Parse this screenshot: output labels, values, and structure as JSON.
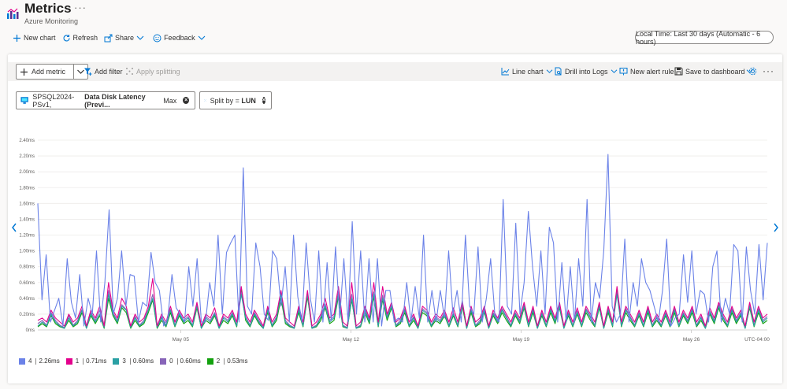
{
  "app": {
    "title": "Metrics",
    "subtitle": "Azure Monitoring",
    "more": "···"
  },
  "commands": {
    "new_chart": "New chart",
    "refresh": "Refresh",
    "share": "Share",
    "feedback": "Feedback",
    "time_range": "Local Time: Last 30 days (Automatic - 6 hours)"
  },
  "toolbar": {
    "add_metric": "Add metric",
    "add_filter": "Add filter",
    "apply_splitting": "Apply splitting",
    "line_chart": "Line chart",
    "drill_into_logs": "Drill into Logs",
    "new_alert_rule": "New alert rule",
    "save_to_dashboard": "Save to dashboard",
    "more": "···"
  },
  "metric_pill": {
    "resource": "SPSQL2024-PSv1,",
    "metric": "Data Disk Latency (Previ...",
    "aggregation": "Max"
  },
  "split_pill": {
    "prefix": "Split by = ",
    "value": "LUN"
  },
  "timezone_label": "UTC-04:00",
  "colors": {
    "accent": "#0078d4",
    "series_4": "#6b82e8",
    "series_1": "#e3008c",
    "series_3": "#2aa0a4",
    "series_0": "#8764b8",
    "series_2": "#13a10e"
  },
  "legend": [
    {
      "name": "4",
      "value": "2.26ms",
      "color": "#6b82e8"
    },
    {
      "name": "1",
      "value": "0.71ms",
      "color": "#e3008c"
    },
    {
      "name": "3",
      "value": "0.60ms",
      "color": "#2aa0a4"
    },
    {
      "name": "0",
      "value": "0.60ms",
      "color": "#8764b8"
    },
    {
      "name": "2",
      "value": "0.53ms",
      "color": "#13a10e"
    }
  ],
  "chart_data": {
    "type": "line",
    "ylabels": [
      "2.40ms",
      "2.20ms",
      "2.00ms",
      "1.80ms",
      "1.60ms",
      "1.40ms",
      "1.20ms",
      "1.00ms",
      "0.80ms",
      "0.60ms",
      "0.40ms",
      "0.20ms",
      "0ms"
    ],
    "ylim": [
      0,
      2.4
    ],
    "xlim": [
      0,
      120
    ],
    "xticks": [
      {
        "label": "May 05",
        "x": 23.5
      },
      {
        "label": "May 12",
        "x": 51.5
      },
      {
        "label": "May 19",
        "x": 79.5
      },
      {
        "label": "May 26",
        "x": 107.5
      }
    ],
    "grid": true,
    "series": [
      {
        "name": "4",
        "color": "#6b82e8",
        "values": [
          1.6,
          0.38,
          0.95,
          0.1,
          0.25,
          0.4,
          0.05,
          0.9,
          0.35,
          0.15,
          0.7,
          0.05,
          0.4,
          0.2,
          1.0,
          0.1,
          0.6,
          1.52,
          0.2,
          0.4,
          1.0,
          0.3,
          0.7,
          0.68,
          0.1,
          0.35,
          0.3,
          0.98,
          0.6,
          0.5,
          0.05,
          0.15,
          0.7,
          0.28,
          0.2,
          0.1,
          0.8,
          0.3,
          0.9,
          0.1,
          0.1,
          0.6,
          0.3,
          1.2,
          0.2,
          0.98,
          1.1,
          1.2,
          0.1,
          2.05,
          0.3,
          0.2,
          1.1,
          0.8,
          0.2,
          0.12,
          1.0,
          0.9,
          0.3,
          0.8,
          0.1,
          1.2,
          0.42,
          0.1,
          1.1,
          0.4,
          0.1,
          1.0,
          0.1,
          0.85,
          0.12,
          1.05,
          0.15,
          0.9,
          0.1,
          1.37,
          0.2,
          1.0,
          0.1,
          0.9,
          0.1,
          0.9,
          0.05,
          0.5,
          0.5,
          0.1,
          0.15,
          0.1,
          0.6,
          0.1,
          0.55,
          0.15,
          1.2,
          0.1,
          0.5,
          0.1,
          0.5,
          0.15,
          1.0,
          0.2,
          0.5,
          0.1,
          1.2,
          0.3,
          0.2,
          1.05,
          0.1,
          0.4,
          0.9,
          0.2,
          0.1,
          1.65,
          0.3,
          0.2,
          1.35,
          0.2,
          0.6,
          1.5,
          0.8,
          0.3,
          1.0,
          0.2,
          1.3,
          1.1,
          0.1,
          0.85,
          0.1,
          0.8,
          0.1,
          0.9,
          0.3,
          1.65,
          0.1,
          0.6,
          0.4,
          1.0,
          2.22,
          0.3,
          0.1,
          0.2,
          1.15,
          0.1,
          0.6,
          0.3,
          0.9,
          0.6,
          0.5,
          0.3,
          0.1,
          0.5,
          1.15,
          0.05,
          0.15,
          0.2,
          0.95,
          0.35,
          1.0,
          0.2,
          0.5,
          0.45,
          0.1,
          0.8,
          1.0,
          0.1,
          0.4,
          0.2,
          1.08,
          1.0,
          0.1,
          1.05,
          0.5,
          0.2,
          1.08,
          0.38,
          1.1
        ]
      },
      {
        "name": "1",
        "color": "#e3008c",
        "values": [
          0.12,
          0.15,
          0.1,
          0.25,
          0.15,
          0.1,
          0.05,
          0.2,
          0.1,
          0.15,
          0.3,
          0.05,
          0.25,
          0.15,
          0.3,
          0.05,
          0.6,
          0.25,
          0.15,
          0.4,
          0.3,
          0.05,
          0.2,
          0.1,
          0.15,
          0.3,
          0.65,
          0.05,
          0.2,
          0.1,
          0.3,
          0.1,
          0.25,
          0.15,
          0.2,
          0.1,
          0.35,
          0.05,
          0.2,
          0.15,
          0.28,
          0.05,
          0.2,
          0.15,
          0.25,
          0.1,
          0.55,
          0.2,
          0.1,
          0.25,
          0.15,
          0.05,
          0.3,
          0.1,
          0.2,
          0.5,
          0.15,
          0.1,
          0.05,
          0.3,
          0.1,
          0.5,
          0.05,
          0.1,
          0.2,
          0.4,
          0.15,
          0.2,
          0.55,
          0.1,
          0.05,
          0.6,
          0.05,
          0.1,
          0.3,
          0.15,
          0.6,
          0.1,
          0.55,
          0.2,
          0.35,
          0.1,
          0.15,
          0.3,
          0.1,
          0.2,
          0.05,
          0.3,
          0.25,
          0.1,
          0.2,
          0.15,
          0.25,
          0.1,
          0.28,
          0.1,
          0.35,
          0.05,
          0.3,
          0.1,
          0.15,
          0.3,
          0.05,
          0.25,
          0.15,
          0.3,
          0.2,
          0.1,
          0.25,
          0.15,
          0.35,
          0.1,
          0.3,
          0.05,
          0.25,
          0.1,
          0.3,
          0.15,
          0.35,
          0.05,
          0.25,
          0.1,
          0.28,
          0.1,
          0.3,
          0.2,
          0.1,
          0.35,
          0.05,
          0.3,
          0.1,
          0.55,
          0.1,
          0.3,
          0.2,
          0.1,
          0.25,
          0.1,
          0.3,
          0.1,
          0.2,
          0.1,
          0.25,
          0.1,
          0.3,
          0.1,
          0.25,
          0.15,
          0.3,
          0.1,
          0.2,
          0.05,
          0.28,
          0.15,
          0.35,
          0.2,
          0.1,
          0.3,
          0.15,
          0.25,
          0.05,
          0.35,
          0.1,
          0.3,
          0.15,
          0.2
        ]
      },
      {
        "name": "3",
        "color": "#2aa0a4",
        "values": [
          0.05,
          0.1,
          0.05,
          0.2,
          0.1,
          0.05,
          0.02,
          0.15,
          0.05,
          0.1,
          0.25,
          0.02,
          0.2,
          0.1,
          0.2,
          0.03,
          0.45,
          0.2,
          0.1,
          0.3,
          0.25,
          0.03,
          0.15,
          0.05,
          0.1,
          0.25,
          0.4,
          0.03,
          0.15,
          0.05,
          0.25,
          0.05,
          0.2,
          0.1,
          0.15,
          0.05,
          0.3,
          0.02,
          0.15,
          0.1,
          0.2,
          0.02,
          0.15,
          0.1,
          0.2,
          0.05,
          0.45,
          0.15,
          0.05,
          0.2,
          0.1,
          0.02,
          0.25,
          0.05,
          0.15,
          0.45,
          0.1,
          0.05,
          0.02,
          0.25,
          0.05,
          0.45,
          0.02,
          0.05,
          0.15,
          0.3,
          0.1,
          0.15,
          0.45,
          0.05,
          0.02,
          0.4,
          0.02,
          0.05,
          0.25,
          0.1,
          0.45,
          0.05,
          0.4,
          0.15,
          0.3,
          0.05,
          0.1,
          0.25,
          0.05,
          0.15,
          0.02,
          0.25,
          0.2,
          0.05,
          0.15,
          0.1,
          0.2,
          0.05,
          0.2,
          0.05,
          0.35,
          0.02,
          0.25,
          0.05,
          0.1,
          0.25,
          0.02,
          0.2,
          0.1,
          0.25,
          0.15,
          0.05,
          0.2,
          0.1,
          0.3,
          0.05,
          0.25,
          0.02,
          0.2,
          0.05,
          0.25,
          0.1,
          0.3,
          0.02,
          0.2,
          0.05,
          0.22,
          0.05,
          0.25,
          0.15,
          0.05,
          0.3,
          0.02,
          0.25,
          0.05,
          0.45,
          0.05,
          0.25,
          0.15,
          0.05,
          0.2,
          0.05,
          0.25,
          0.05,
          0.15,
          0.05,
          0.2,
          0.05,
          0.25,
          0.05,
          0.2,
          0.1,
          0.25,
          0.05,
          0.15,
          0.02,
          0.22,
          0.1,
          0.3,
          0.15,
          0.05,
          0.25,
          0.1,
          0.2,
          0.02,
          0.3,
          0.05,
          0.25,
          0.1,
          0.15
        ]
      },
      {
        "name": "0",
        "color": "#8764b8",
        "values": [
          0.08,
          0.12,
          0.06,
          0.22,
          0.12,
          0.06,
          0.03,
          0.18,
          0.06,
          0.12,
          0.26,
          0.03,
          0.22,
          0.12,
          0.25,
          0.04,
          0.5,
          0.22,
          0.12,
          0.32,
          0.26,
          0.04,
          0.17,
          0.06,
          0.12,
          0.26,
          0.45,
          0.04,
          0.17,
          0.06,
          0.26,
          0.06,
          0.22,
          0.12,
          0.17,
          0.06,
          0.32,
          0.03,
          0.17,
          0.12,
          0.22,
          0.03,
          0.17,
          0.12,
          0.22,
          0.06,
          0.48,
          0.17,
          0.06,
          0.22,
          0.12,
          0.03,
          0.27,
          0.06,
          0.17,
          0.47,
          0.12,
          0.06,
          0.03,
          0.27,
          0.06,
          0.47,
          0.03,
          0.06,
          0.17,
          0.33,
          0.12,
          0.17,
          0.48,
          0.06,
          0.03,
          0.45,
          0.03,
          0.06,
          0.27,
          0.12,
          0.48,
          0.06,
          0.44,
          0.17,
          0.32,
          0.06,
          0.12,
          0.27,
          0.06,
          0.17,
          0.03,
          0.27,
          0.22,
          0.06,
          0.17,
          0.12,
          0.22,
          0.06,
          0.22,
          0.06,
          0.37,
          0.03,
          0.27,
          0.06,
          0.12,
          0.27,
          0.03,
          0.22,
          0.12,
          0.27,
          0.17,
          0.06,
          0.22,
          0.12,
          0.32,
          0.06,
          0.27,
          0.03,
          0.22,
          0.06,
          0.27,
          0.12,
          0.32,
          0.03,
          0.22,
          0.06,
          0.24,
          0.06,
          0.27,
          0.17,
          0.06,
          0.32,
          0.03,
          0.27,
          0.06,
          0.48,
          0.06,
          0.27,
          0.17,
          0.06,
          0.22,
          0.06,
          0.27,
          0.06,
          0.17,
          0.06,
          0.22,
          0.06,
          0.27,
          0.06,
          0.22,
          0.12,
          0.27,
          0.06,
          0.17,
          0.03,
          0.24,
          0.12,
          0.32,
          0.17,
          0.06,
          0.27,
          0.12,
          0.22,
          0.03,
          0.32,
          0.06,
          0.27,
          0.12,
          0.17
        ]
      },
      {
        "name": "2",
        "color": "#13a10e",
        "values": [
          0.04,
          0.08,
          0.04,
          0.18,
          0.08,
          0.04,
          0.02,
          0.12,
          0.04,
          0.08,
          0.22,
          0.02,
          0.18,
          0.08,
          0.18,
          0.02,
          0.4,
          0.18,
          0.08,
          0.28,
          0.22,
          0.02,
          0.12,
          0.04,
          0.08,
          0.22,
          0.38,
          0.02,
          0.12,
          0.04,
          0.22,
          0.04,
          0.18,
          0.08,
          0.12,
          0.04,
          0.28,
          0.02,
          0.12,
          0.08,
          0.18,
          0.02,
          0.12,
          0.08,
          0.18,
          0.04,
          0.5,
          0.12,
          0.04,
          0.18,
          0.08,
          0.02,
          0.22,
          0.04,
          0.12,
          0.4,
          0.08,
          0.04,
          0.02,
          0.22,
          0.04,
          0.42,
          0.02,
          0.04,
          0.12,
          0.28,
          0.08,
          0.12,
          0.42,
          0.04,
          0.02,
          0.38,
          0.02,
          0.04,
          0.22,
          0.08,
          0.42,
          0.04,
          0.38,
          0.12,
          0.28,
          0.04,
          0.08,
          0.22,
          0.04,
          0.12,
          0.02,
          0.22,
          0.18,
          0.04,
          0.12,
          0.08,
          0.18,
          0.04,
          0.18,
          0.04,
          0.3,
          0.02,
          0.22,
          0.04,
          0.08,
          0.22,
          0.02,
          0.18,
          0.08,
          0.22,
          0.12,
          0.04,
          0.18,
          0.08,
          0.28,
          0.04,
          0.22,
          0.02,
          0.18,
          0.04,
          0.22,
          0.08,
          0.28,
          0.02,
          0.18,
          0.04,
          0.2,
          0.04,
          0.22,
          0.12,
          0.04,
          0.28,
          0.02,
          0.22,
          0.04,
          0.52,
          0.04,
          0.22,
          0.12,
          0.04,
          0.18,
          0.04,
          0.22,
          0.04,
          0.12,
          0.04,
          0.18,
          0.04,
          0.22,
          0.04,
          0.18,
          0.08,
          0.22,
          0.04,
          0.12,
          0.02,
          0.2,
          0.08,
          0.28,
          0.12,
          0.04,
          0.22,
          0.08,
          0.18,
          0.02,
          0.28,
          0.04,
          0.22,
          0.08,
          0.12
        ]
      }
    ]
  }
}
